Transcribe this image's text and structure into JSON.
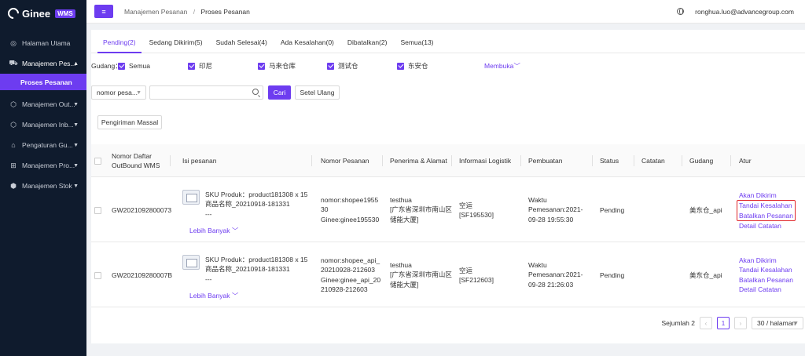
{
  "app": {
    "logo_text": "Ginee",
    "logo_badge": "WMS"
  },
  "sidebar": {
    "items": [
      {
        "label": "Halaman Utama",
        "icon": "dashboard-icon"
      },
      {
        "label": "Manajemen Pes...",
        "icon": "cart-icon",
        "open": true
      },
      {
        "label": "Manajemen Out...",
        "icon": "outbound-icon"
      },
      {
        "label": "Manajemen Inb...",
        "icon": "inbound-icon"
      },
      {
        "label": "Pengaturan Gu...",
        "icon": "warehouse-icon"
      },
      {
        "label": "Manajemen Pro...",
        "icon": "product-icon"
      },
      {
        "label": "Manajemen Stok",
        "icon": "stock-icon"
      }
    ],
    "active_sub": "Proses Pesanan"
  },
  "header": {
    "breadcrumb_parent": "Manajemen Pesanan",
    "breadcrumb_sep": "/",
    "breadcrumb_current": "Proses Pesanan",
    "user_email": "ronghua.luo@advancegroup.com"
  },
  "tabs": [
    {
      "label": "Pending(2)",
      "active": true
    },
    {
      "label": "Sedang Dikirim(5)"
    },
    {
      "label": "Sudah Selesai(4)"
    },
    {
      "label": "Ada Kesalahan(0)"
    },
    {
      "label": "Dibatalkan(2)"
    },
    {
      "label": "Semua(13)"
    }
  ],
  "warehouse_filter": {
    "label": "Gudang：",
    "options": [
      "Semua",
      "印尼",
      "马来仓库",
      "测试仓",
      "东安仓"
    ],
    "expand_label": "Membuka"
  },
  "search": {
    "field_select": "nomor pesa...",
    "query": "",
    "search_button": "Cari",
    "reset_button": "Setel Ulang"
  },
  "bulk_button": "Pengiriman Massal",
  "table": {
    "headers": {
      "outbound": [
        "Nomor Daftar",
        "OutBound WMS"
      ],
      "content": "Isi pesanan",
      "order_no": "Nomor Pesanan",
      "recipient": "Penerima & Alamat",
      "logistics": "Informasi Logistik",
      "created": "Pembuatan",
      "status": "Status",
      "notes": "Catatan",
      "warehouse": "Gudang",
      "actions": "Atur"
    },
    "rows": [
      {
        "outbound_no": "GW2021092800073",
        "content_lines": [
          "SKU Produk：product181308 x 15",
          "商品名称_20210918-181331",
          "---"
        ],
        "more_label": "Lebih Banyak",
        "order_lines": [
          "nomor:shopee1955",
          "30",
          "Ginee:ginee195530"
        ],
        "recipient_lines": [
          "testhua",
          "[广东省深圳市南山区",
          "储能大厦]"
        ],
        "logistics_lines": [
          "空运",
          "[SF195530]"
        ],
        "created_lines": [
          "Waktu",
          "Pemesanan:2021-",
          "09-28 19:55:30"
        ],
        "status": "Pending",
        "warehouse": "美东仓_api",
        "actions": {
          "ship": "Akan Dikirim",
          "mark_error": "Tandai Kesalahan",
          "cancel": "Batalkan Pesanan",
          "detail": "Detail",
          "note": "Catatan"
        }
      },
      {
        "outbound_no": "GW202109280007B",
        "content_lines": [
          "SKU Produk：product181308 x 15",
          "商品名称_20210918-181331",
          "---"
        ],
        "more_label": "Lebih Banyak",
        "order_lines": [
          "nomor:shopee_api_",
          "20210928-212603",
          "Ginee:ginee_api_20",
          "210928-212603"
        ],
        "recipient_lines": [
          "testhua",
          "[广东省深圳市南山区",
          "储能大厦]"
        ],
        "logistics_lines": [
          "空运",
          "[SF212603]"
        ],
        "created_lines": [
          "Waktu",
          "Pemesanan:2021-",
          "09-28 21:26:03"
        ],
        "status": "Pending",
        "warehouse": "美东仓_api",
        "actions": {
          "ship": "Akan Dikirim",
          "mark_error": "Tandai Kesalahan",
          "cancel": "Batalkan Pesanan",
          "detail": "Detail",
          "note": "Catatan"
        }
      }
    ]
  },
  "pagination": {
    "total_label": "Sejumlah 2",
    "prev": "‹",
    "current": "1",
    "next": "›",
    "page_size": "30 / halaman"
  },
  "colors": {
    "accent": "#6d3cf0",
    "sidebar_bg": "#0f1b2d",
    "highlight_border": "#e0262a"
  }
}
